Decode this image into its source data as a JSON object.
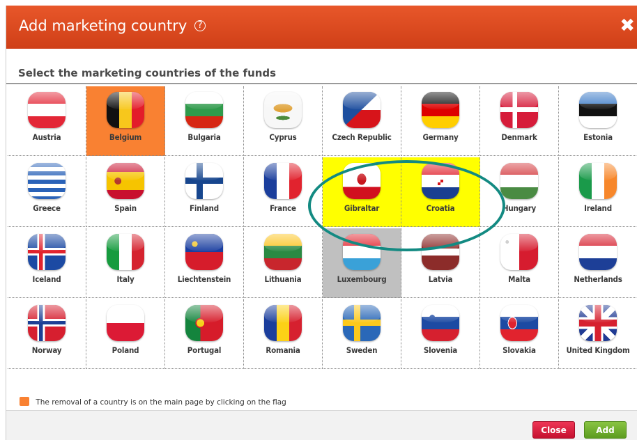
{
  "dialog": {
    "title": "Add marketing country",
    "help_icon": "?",
    "close_icon": "✖",
    "subtitle": "Select the marketing countries of the funds"
  },
  "countries": [
    {
      "name": "Austria"
    },
    {
      "name": "Belgium",
      "state": "selected-orange"
    },
    {
      "name": "Bulgaria"
    },
    {
      "name": "Cyprus"
    },
    {
      "name": "Czech Republic"
    },
    {
      "name": "Germany"
    },
    {
      "name": "Denmark"
    },
    {
      "name": "Estonia"
    },
    {
      "name": "Greece"
    },
    {
      "name": "Spain"
    },
    {
      "name": "Finland"
    },
    {
      "name": "France"
    },
    {
      "name": "Gibraltar",
      "state": "highlight-yellow"
    },
    {
      "name": "Croatia",
      "state": "highlight-yellow"
    },
    {
      "name": "Hungary"
    },
    {
      "name": "Ireland"
    },
    {
      "name": "Iceland"
    },
    {
      "name": "Italy"
    },
    {
      "name": "Liechtenstein"
    },
    {
      "name": "Lithuania"
    },
    {
      "name": "Luxembourg",
      "state": "hover-gray"
    },
    {
      "name": "Latvia"
    },
    {
      "name": "Malta"
    },
    {
      "name": "Netherlands"
    },
    {
      "name": "Norway"
    },
    {
      "name": "Poland"
    },
    {
      "name": "Portugal"
    },
    {
      "name": "Romania"
    },
    {
      "name": "Sweden"
    },
    {
      "name": "Slovenia"
    },
    {
      "name": "Slovakia"
    },
    {
      "name": "United Kingdom"
    }
  ],
  "legend": {
    "text": "The removal of a country is on the main page by clicking on the flag",
    "color": "#f98132"
  },
  "buttons": {
    "close_label": "Close",
    "add_label": "Add"
  },
  "colors": {
    "header": "#d9461d",
    "highlight": "#ffff00",
    "annotation_ring": "#138a82",
    "close_button": "#d81e3f",
    "add_button": "#72b030"
  }
}
